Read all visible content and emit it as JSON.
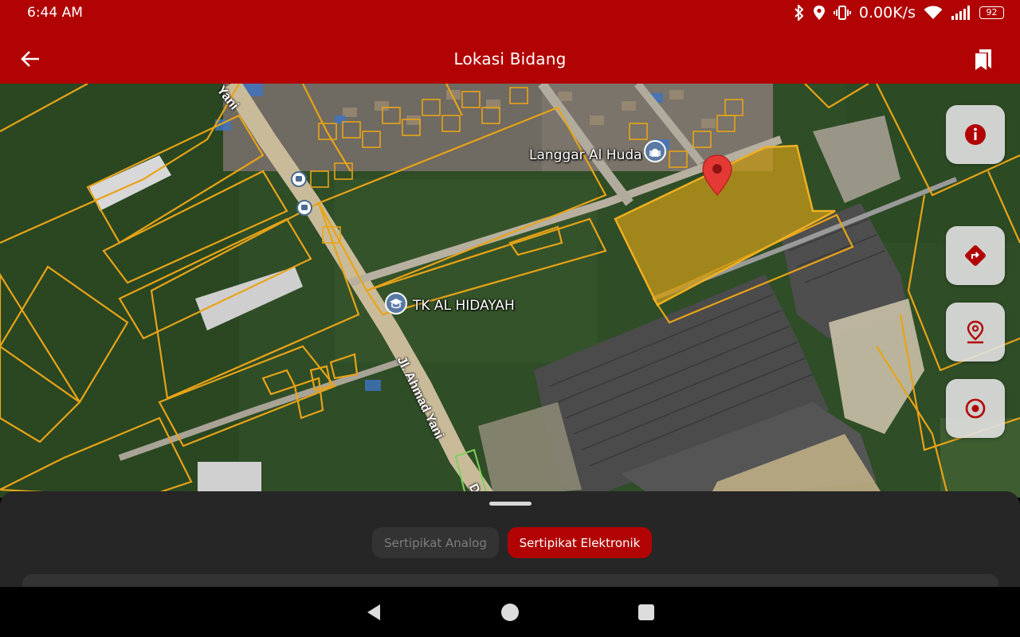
{
  "status": {
    "time": "6:44 AM",
    "net_speed": "0.00K/s",
    "battery": "92",
    "icons": [
      "bluetooth-icon",
      "location-icon",
      "vibrate-icon",
      "wifi-icon",
      "signal-icon",
      "battery-icon"
    ]
  },
  "appbar": {
    "title": "Lokasi Bidang",
    "back_icon": "arrow-left-icon",
    "bookmark_icon": "bookmarks-icon",
    "color": "#b10303"
  },
  "map": {
    "labels": {
      "mosque": "Langgar Al Huda",
      "school": "TK AL HIDAYAH",
      "road_main": "Jl. Ahmad Yani",
      "road_main_top": "Yani",
      "road_edge": "D"
    },
    "parcel_color": "#e8a317",
    "selected_parcel_fill": "#c89a1a",
    "pin_color": "#e53935",
    "fabs": [
      {
        "name": "info-button",
        "icon": "info-icon"
      },
      {
        "name": "directions-button",
        "icon": "directions-icon"
      },
      {
        "name": "location-pin-button",
        "icon": "location-pin-icon"
      },
      {
        "name": "my-location-button",
        "icon": "target-icon"
      }
    ]
  },
  "sheet": {
    "tabs": [
      {
        "label": "Sertipikat Analog",
        "selected": false
      },
      {
        "label": "Sertipikat Elektronik",
        "selected": true
      }
    ]
  },
  "navbar": {
    "buttons": [
      "back-triangle-icon",
      "home-circle-icon",
      "recents-square-icon"
    ]
  }
}
